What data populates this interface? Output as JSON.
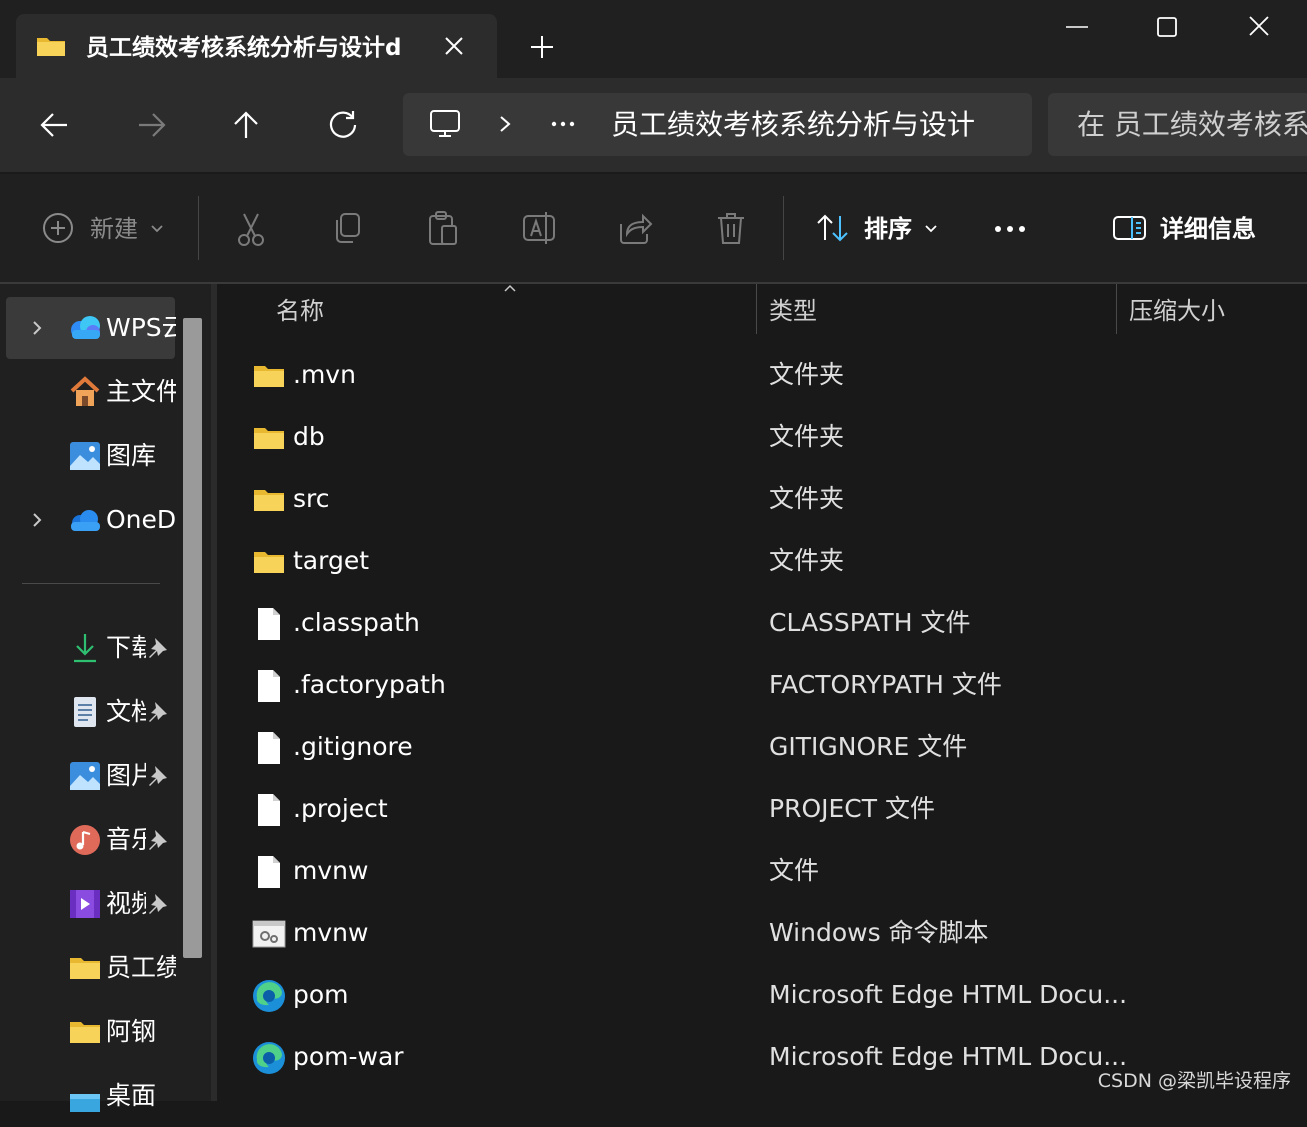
{
  "window": {
    "tab_title": "员工绩效考核系统分析与设计d",
    "tab_icon": "folder-icon",
    "controls": [
      "minimize-icon",
      "maximize-icon",
      "close-icon"
    ]
  },
  "address_bar": {
    "path_segment": "员工绩效考核系统分析与设计",
    "search_placeholder": "在 员工绩效考核系"
  },
  "toolbar": {
    "new_label": "新建",
    "sort_label": "排序",
    "details_label": "详细信息"
  },
  "sidebar": {
    "items": [
      {
        "label": "WPS云",
        "icon": "wps-cloud-icon",
        "expandable": true,
        "pinned": false
      },
      {
        "label": "主文件",
        "icon": "home-icon",
        "expandable": false,
        "pinned": false
      },
      {
        "label": "图库",
        "icon": "gallery-icon",
        "expandable": false,
        "pinned": false
      },
      {
        "label": "OneD",
        "icon": "onedrive-icon",
        "expandable": true,
        "pinned": false
      },
      {
        "label": "下载",
        "icon": "download-icon",
        "expandable": false,
        "pinned": true
      },
      {
        "label": "文档",
        "icon": "documents-icon",
        "expandable": false,
        "pinned": true
      },
      {
        "label": "图片",
        "icon": "pictures-icon",
        "expandable": false,
        "pinned": true
      },
      {
        "label": "音乐",
        "icon": "music-icon",
        "expandable": false,
        "pinned": true
      },
      {
        "label": "视频",
        "icon": "videos-icon",
        "expandable": false,
        "pinned": true
      },
      {
        "label": "员工绩",
        "icon": "folder-icon",
        "expandable": false,
        "pinned": false
      },
      {
        "label": "阿钢",
        "icon": "folder-icon",
        "expandable": false,
        "pinned": false
      },
      {
        "label": "桌面",
        "icon": "desktop-icon",
        "expandable": false,
        "pinned": false
      }
    ]
  },
  "columns": {
    "name": "名称",
    "type": "类型",
    "size": "压缩大小"
  },
  "files": [
    {
      "name": ".mvn",
      "type": "文件夹",
      "icon": "folder-icon"
    },
    {
      "name": "db",
      "type": "文件夹",
      "icon": "folder-icon"
    },
    {
      "name": "src",
      "type": "文件夹",
      "icon": "folder-icon"
    },
    {
      "name": "target",
      "type": "文件夹",
      "icon": "folder-icon"
    },
    {
      "name": ".classpath",
      "type": "CLASSPATH 文件",
      "icon": "file-icon"
    },
    {
      "name": ".factorypath",
      "type": "FACTORYPATH 文件",
      "icon": "file-icon"
    },
    {
      "name": ".gitignore",
      "type": "GITIGNORE 文件",
      "icon": "file-icon"
    },
    {
      "name": ".project",
      "type": "PROJECT 文件",
      "icon": "file-icon"
    },
    {
      "name": "mvnw",
      "type": "文件",
      "icon": "file-icon"
    },
    {
      "name": "mvnw",
      "type": "Windows 命令脚本",
      "icon": "script-icon"
    },
    {
      "name": "pom",
      "type": "Microsoft Edge HTML Docu...",
      "icon": "edge-icon"
    },
    {
      "name": "pom-war",
      "type": "Microsoft Edge HTML Docu...",
      "icon": "edge-icon"
    }
  ],
  "watermark": "CSDN @梁凯毕设程序",
  "colors": {
    "background": "#191919",
    "panel": "#202020",
    "folder": "#f8c93a",
    "accent": "#4cc2ff"
  }
}
